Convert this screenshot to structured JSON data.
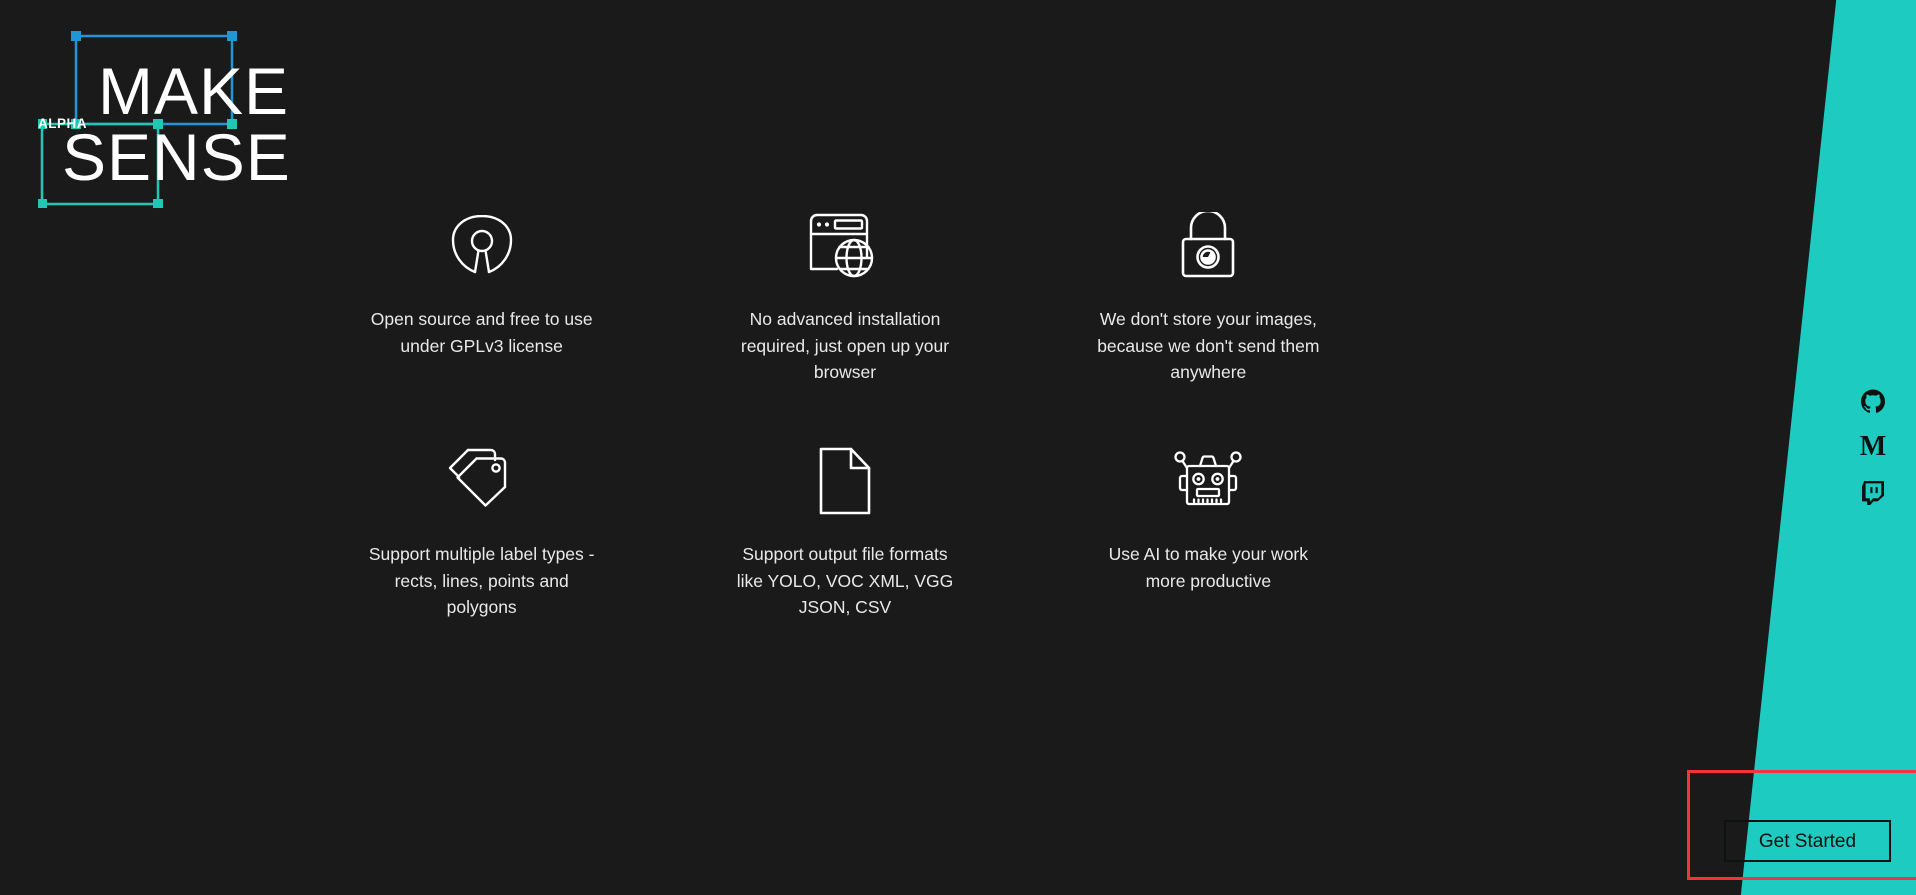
{
  "theme": {
    "background": "#1a1a1a",
    "accent_teal": "#1ecbc0",
    "logo_box_blue": "#2196d6",
    "logo_box_teal": "#21c7b4",
    "highlight_red": "#f4333d",
    "text": "#e9e9e9"
  },
  "logo": {
    "line1": "MAKE",
    "line2": "SENSE",
    "badge": "ALPHA"
  },
  "features": [
    {
      "icon": "open-source-icon",
      "text": "Open source and free to use under GPLv3 license"
    },
    {
      "icon": "browser-globe-icon",
      "text": "No advanced installation required, just open up your browser"
    },
    {
      "icon": "lock-privacy-icon",
      "text": "We don't store your images, because we don't send them anywhere"
    },
    {
      "icon": "tags-icon",
      "text": "Support multiple label types - rects, lines, points and polygons"
    },
    {
      "icon": "document-icon",
      "text": "Support output file formats like YOLO, VOC XML, VGG JSON, CSV"
    },
    {
      "icon": "robot-icon",
      "text": "Use AI to make your work more productive"
    }
  ],
  "social": [
    {
      "icon": "github-icon",
      "label": "GitHub"
    },
    {
      "icon": "medium-icon",
      "label": "M"
    },
    {
      "icon": "twitch-icon",
      "label": "Twitch"
    }
  ],
  "cta": {
    "label": "Get Started"
  }
}
